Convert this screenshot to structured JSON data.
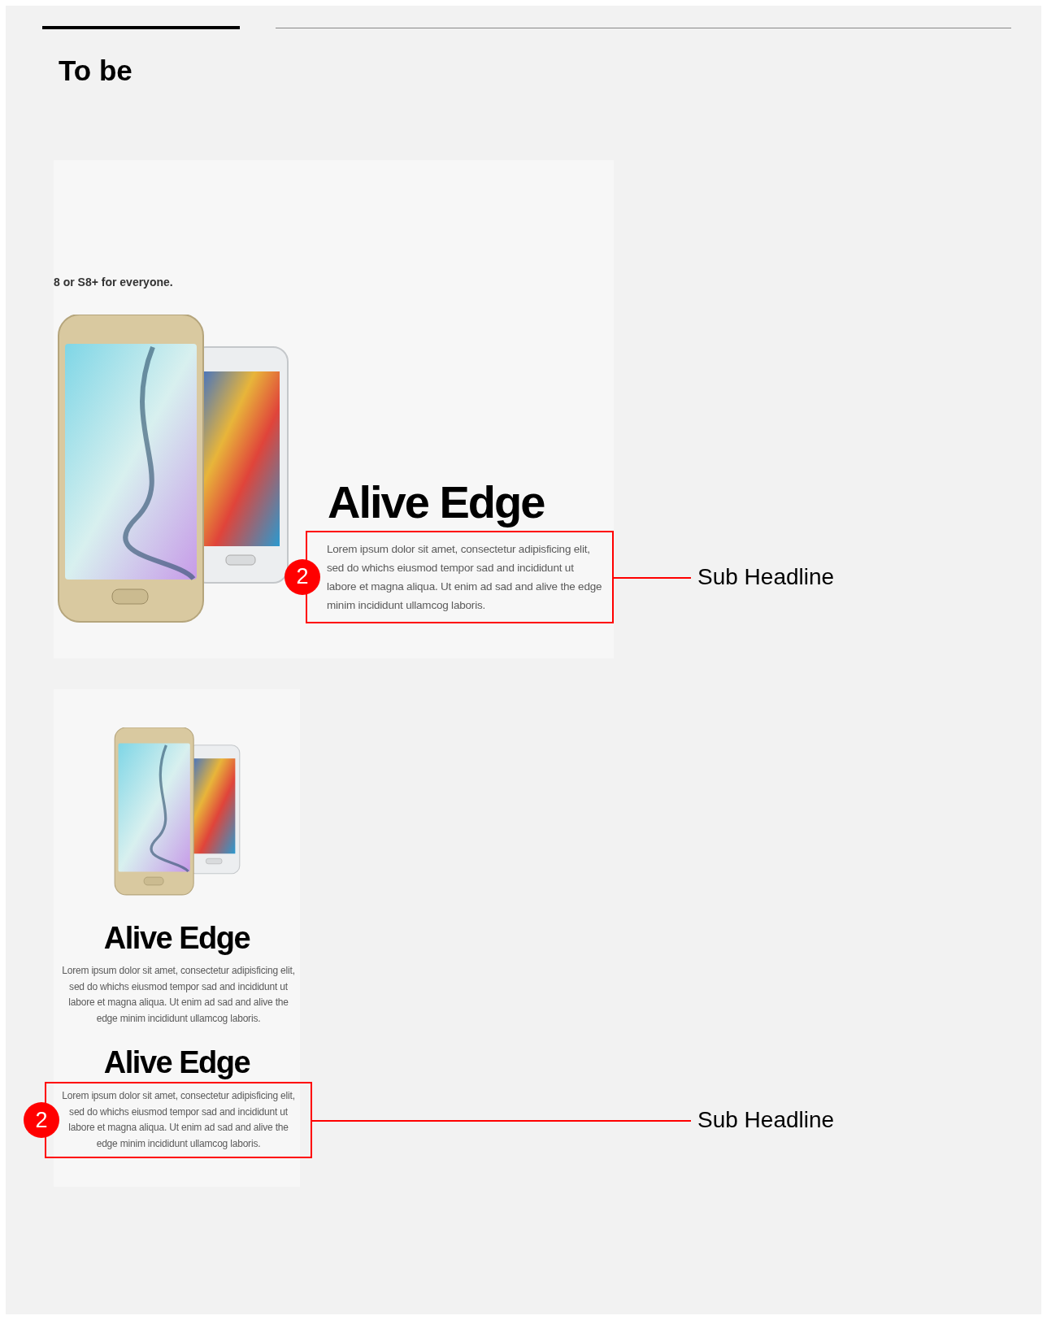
{
  "header": {
    "title": "To be"
  },
  "mockups": [
    {
      "kind": "desktop",
      "cut_text": "8 or S8+ for everyone.",
      "sections": [
        {
          "headline": "Alive Edge",
          "paragraph": "Lorem ipsum dolor sit amet, consectetur adipisficing elit, sed do whichs eiusmod tempor sad and incididunt ut labore et magna aliqua. Ut enim ad sad and alive the edge minim incididunt ullamcog laboris.",
          "highlighted": true,
          "annotation": {
            "number": "2",
            "label": "Sub Headline"
          }
        }
      ]
    },
    {
      "kind": "mobile",
      "sections": [
        {
          "headline": "Alive Edge",
          "paragraph": "Lorem ipsum dolor sit amet, consectetur adipisficing elit, sed do whichs eiusmod tempor sad and incididunt ut labore et magna aliqua. Ut enim ad sad and alive the edge minim incididunt ullamcog laboris.",
          "highlighted": false
        },
        {
          "headline": "Alive Edge",
          "paragraph": "Lorem ipsum dolor sit amet, consectetur adipisficing elit, sed do whichs eiusmod tempor sad and incididunt ut labore et magna aliqua. Ut enim ad sad and alive the edge minim incididunt ullamcog laboris.",
          "highlighted": true,
          "annotation": {
            "number": "2",
            "label": "Sub Headline"
          }
        }
      ]
    }
  ]
}
